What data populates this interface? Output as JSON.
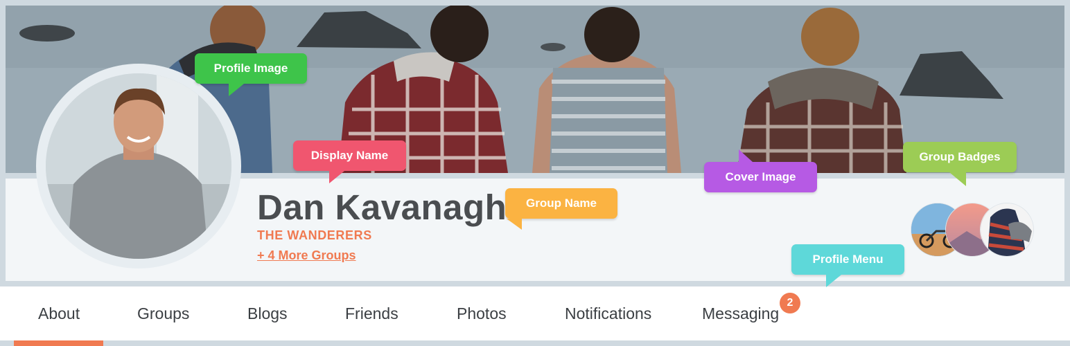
{
  "profile": {
    "display_name": "Dan Kavanagh",
    "group_name": "THE WANDERERS",
    "more_groups": "+ 4 More Groups"
  },
  "menu": {
    "items": [
      {
        "label": "About"
      },
      {
        "label": "Groups"
      },
      {
        "label": "Blogs"
      },
      {
        "label": "Friends"
      },
      {
        "label": "Photos"
      },
      {
        "label": "Notifications"
      },
      {
        "label": "Messaging"
      }
    ],
    "active": "About",
    "messaging_count": "2"
  },
  "callouts": {
    "profile_image": "Profile Image",
    "display_name": "Display Name",
    "group_name": "Group Name",
    "cover_image": "Cover Image",
    "group_badges": "Group Badges",
    "profile_menu": "Profile Menu"
  },
  "colors": {
    "accent": "#f07a51",
    "callout_profile_image": "#3ec44a",
    "callout_display_name": "#f0566f",
    "callout_group_name": "#fbb342",
    "callout_cover_image": "#b65ae4",
    "callout_group_badges": "#9ccc55",
    "callout_profile_menu": "#5ed8d9"
  }
}
